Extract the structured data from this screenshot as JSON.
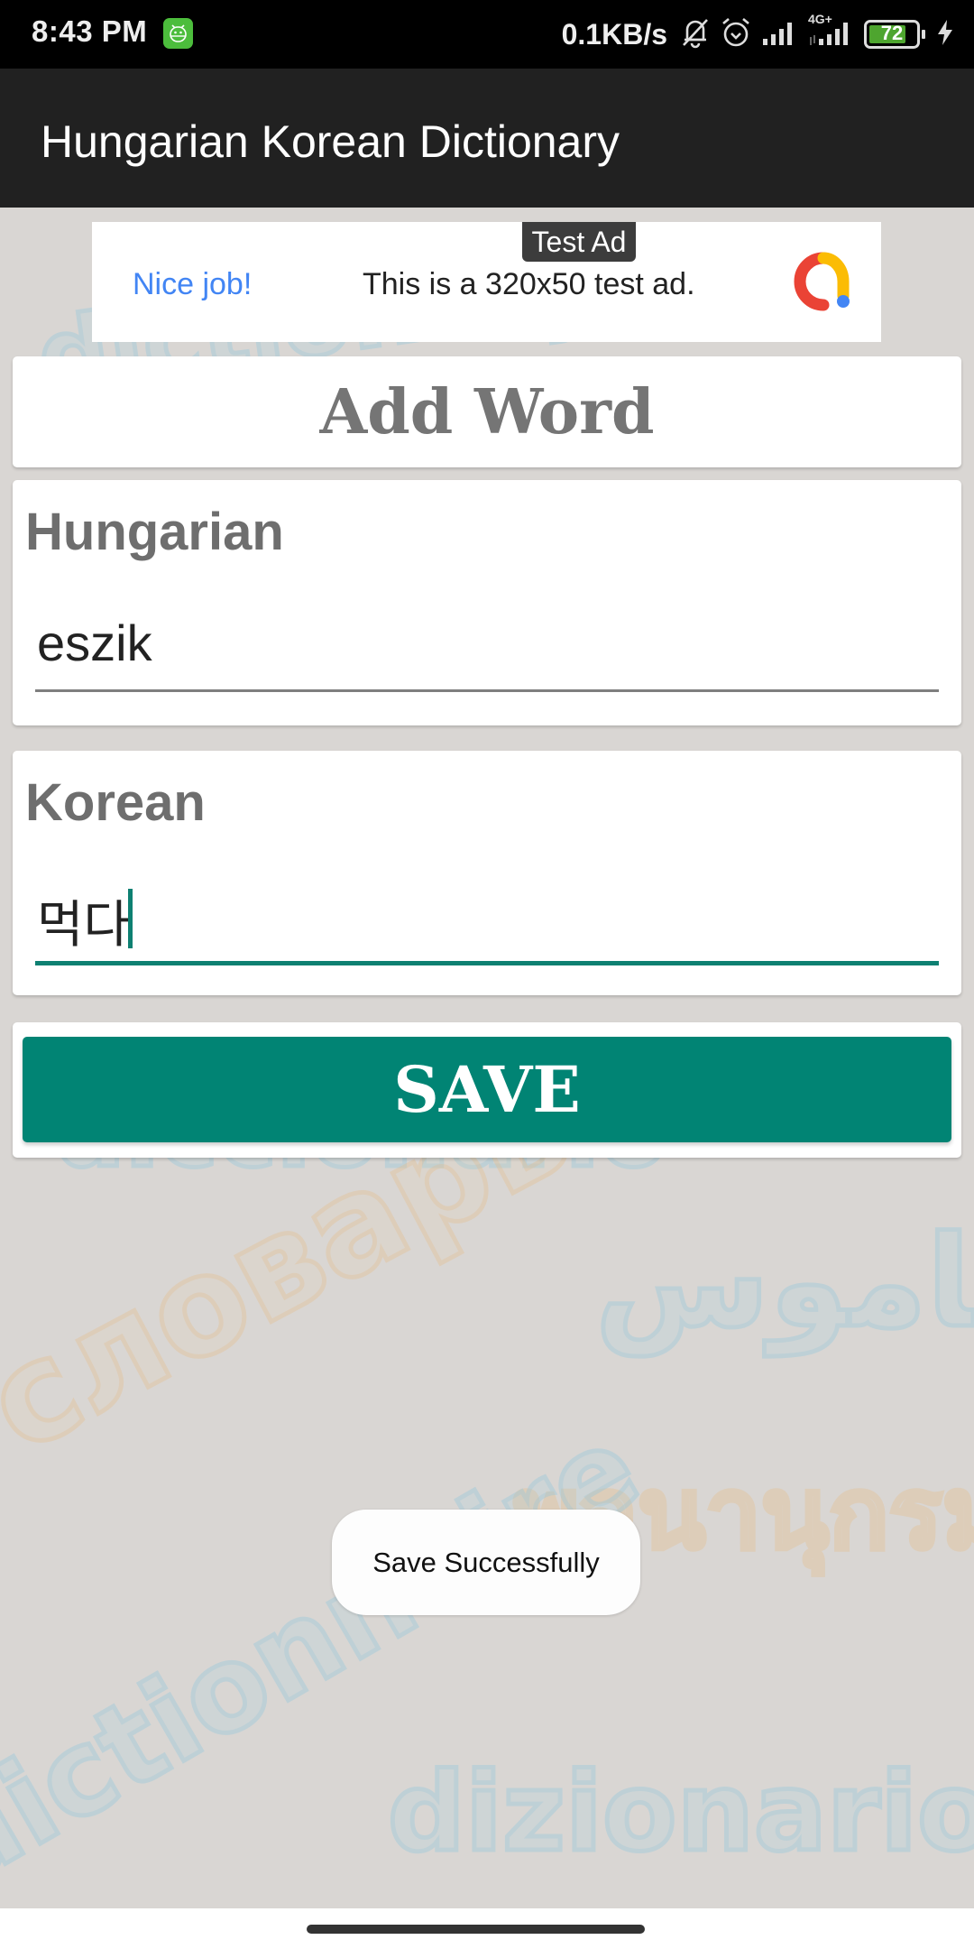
{
  "status_bar": {
    "time": "8:43 PM",
    "network_speed": "0.1KB/s",
    "network_type": "4G+",
    "battery_level": "72",
    "icons": [
      "app-notification-icon",
      "bell-muted-icon",
      "alarm-icon",
      "signal-icon",
      "signal-4g-icon",
      "battery-icon",
      "charging-bolt-icon"
    ]
  },
  "app_bar": {
    "title": "Hungarian Korean Dictionary"
  },
  "ad_banner": {
    "badge": "Test Ad",
    "headline": "Nice job!",
    "body": "This is a 320x50 test ad.",
    "logo_icon": "admob-logo-icon"
  },
  "form": {
    "title": "Add Word",
    "fields": [
      {
        "label": "Hungarian",
        "value": "eszik",
        "focused": false
      },
      {
        "label": "Korean",
        "value": "먹다",
        "focused": true
      }
    ],
    "save_label": "SAVE"
  },
  "background": {
    "watermarks": [
      "dictionary",
      "diccionario",
      "словарь",
      "قاموس",
      "พจนานุกรม",
      "dictionnaire",
      "dizionario"
    ]
  },
  "toast": {
    "message": "Save Successfully"
  },
  "colors": {
    "accent": "#018474",
    "app_bar": "#212121",
    "ad_link": "#4285f4"
  }
}
